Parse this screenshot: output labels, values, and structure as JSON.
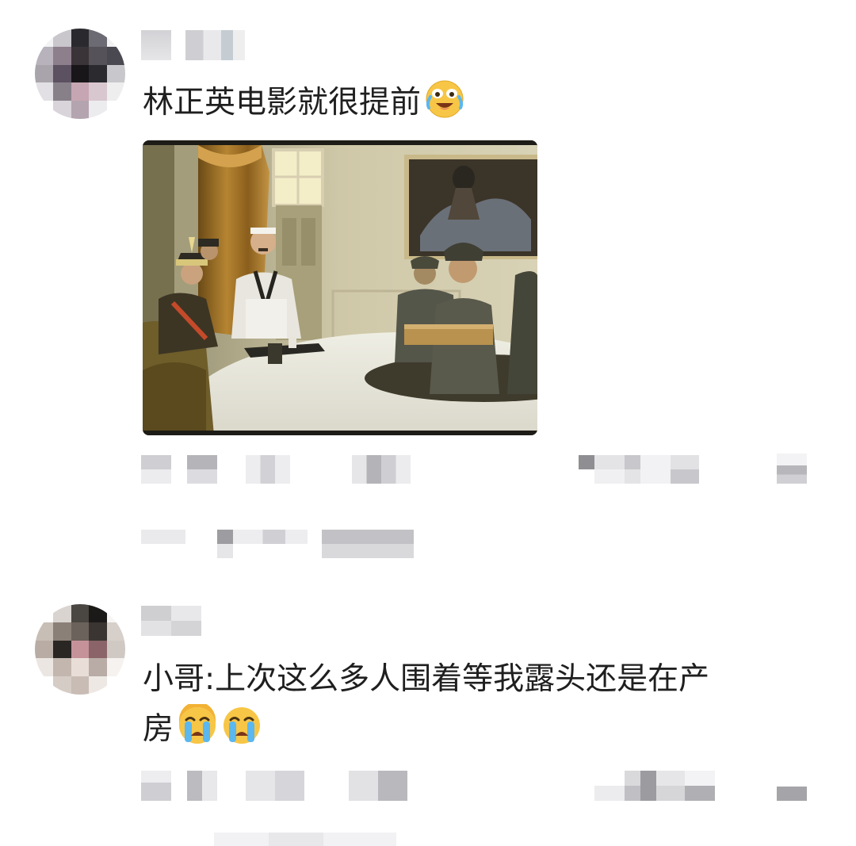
{
  "comments": [
    {
      "text": "林正英电影就很提前",
      "emojis": [
        "laugh-cry-emoji"
      ],
      "has_image": true,
      "image_description": "movie-still-officers-round-table"
    },
    {
      "text_line1": "小哥:上次这么多人围着等我露头还是在产",
      "text_line2": "房",
      "emojis": [
        "loudly-crying-emoji",
        "loudly-crying-emoji"
      ],
      "has_image": false
    }
  ],
  "colors": {
    "text": "#1f1f1f",
    "blur_light": "#e8e8ea",
    "blur_mid": "#c9c9cc",
    "blur_dark": "#9b9b9f",
    "background": "#ffffff"
  }
}
